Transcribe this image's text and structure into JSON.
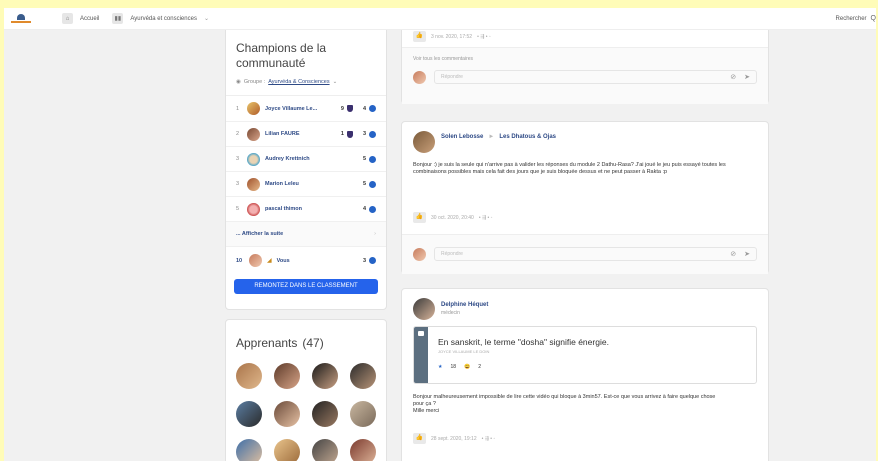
{
  "topbar": {
    "home": "Accueil",
    "course": "Ayurvéda et consciences",
    "search": "Rechercher"
  },
  "champions": {
    "title": "Champions de la communauté",
    "group_label": "Groupe :",
    "group": "Ayurvéda & Consciences",
    "rows": [
      {
        "rank": "1",
        "name": "Joyce Villaume Le...",
        "badge": "9",
        "points": "4"
      },
      {
        "rank": "2",
        "name": "Lilian FAURE",
        "badge": "1",
        "points": "3"
      },
      {
        "rank": "3",
        "name": "Audrey Krettnich",
        "badge": "",
        "points": "5"
      },
      {
        "rank": "3",
        "name": "Marion Leleu",
        "badge": "",
        "points": "5"
      },
      {
        "rank": "5",
        "name": "pascal thimon",
        "badge": "",
        "points": "4"
      }
    ],
    "show_more": "... Afficher la suite",
    "you": {
      "rank": "10",
      "name": "Vous",
      "points": "3"
    },
    "button": "REMONTEZ DANS LE CLASSEMENT"
  },
  "learners": {
    "title": "Apprenants",
    "count": "(47)"
  },
  "post0": {
    "date": "3 nov. 2020, 17:52",
    "view_all": "Voir tous les commentaires",
    "reply": "Répondre"
  },
  "post1": {
    "author": "Solen Lebosse",
    "group": "Les Dhatous & Ojas",
    "body": "Bonjour :) je suis la seule qui n'arrive pas à valider les réponses du module 2 Dathu-Rasa? J'ai joué le jeu puis essayé toutes les combinaisons possibles mais cela fait des jours que je suis bloquée dessus et ne peut passer à Rakta :p",
    "date": "30 oct. 2020, 20:40",
    "reply": "Répondre"
  },
  "post2": {
    "author": "Delphine Héquet",
    "role": "médecin",
    "quote": "En sanskrit, le terme \"dosha\" signifie énergie.",
    "quote_author": "JOYCE VILLAUME LE DOIN",
    "q_like": "18",
    "q_laugh": "2",
    "body1": "Bonjour malheureusement impossible de lire cette vidéo qui bloque à 3min57. Est-ce que vous arrivez à faire quelque chose pour ça ?",
    "body2": "Mille merci",
    "date": "28 sept. 2020, 19:12"
  },
  "colors": {
    "accent": "#2563eb",
    "link": "#2e4a86"
  }
}
